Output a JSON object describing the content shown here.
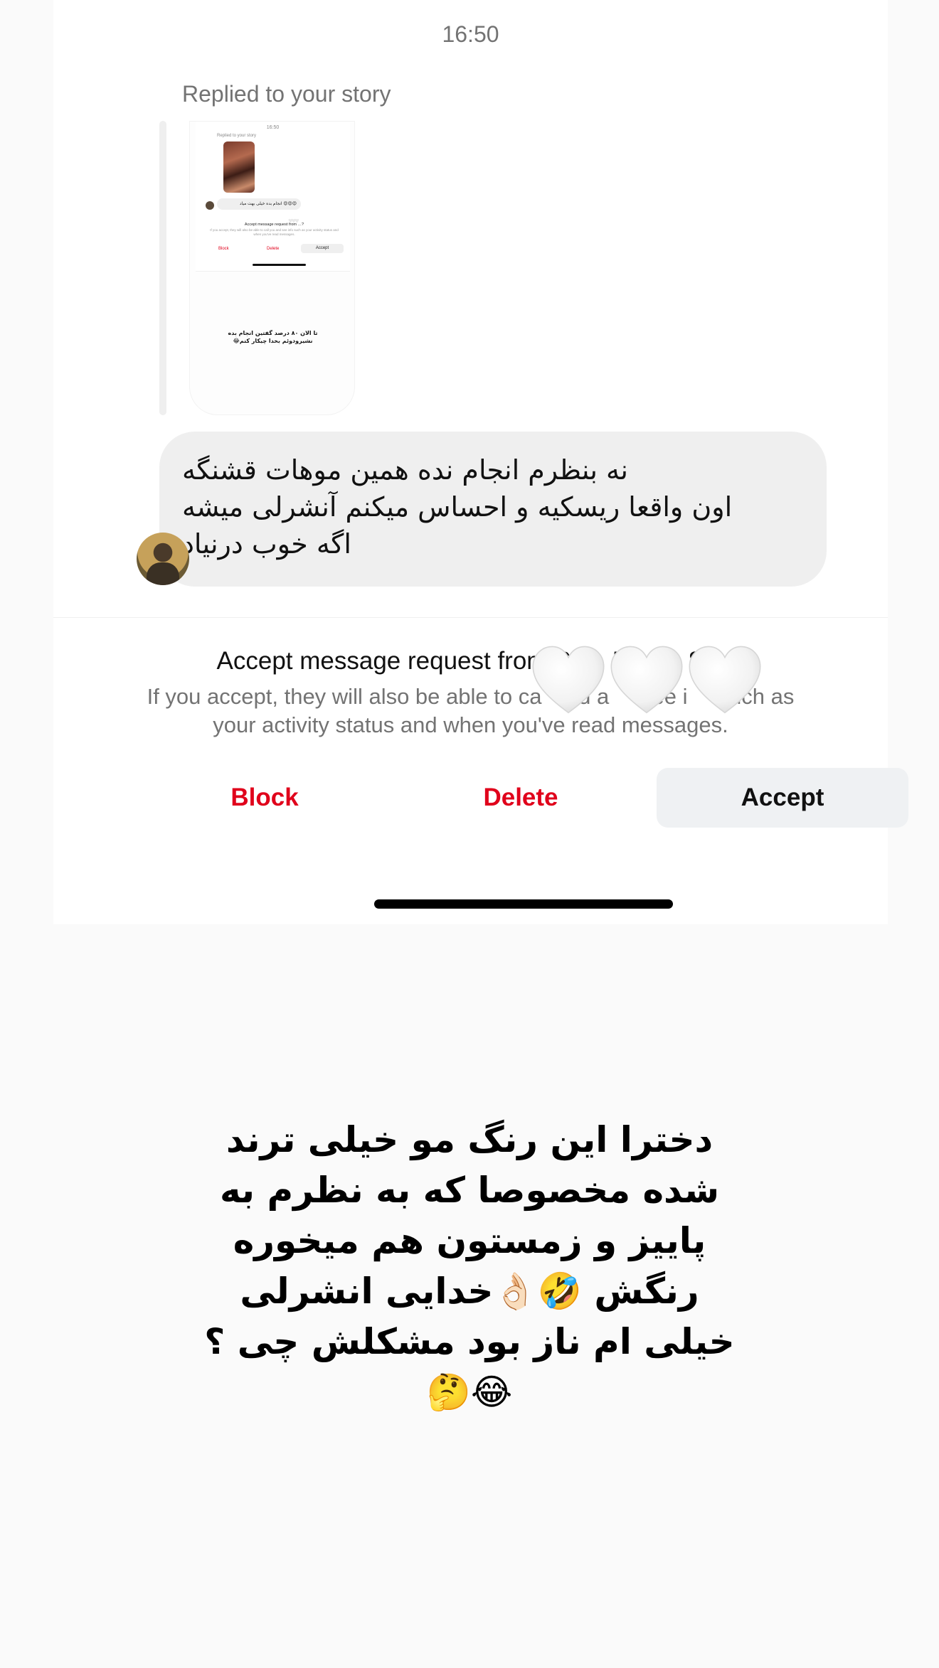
{
  "thread": {
    "timestamp": "16:50",
    "reply_label": "Replied to your story",
    "story_preview": {
      "time": "16:50",
      "replied_label": "Replied to your story",
      "message": "انجام بده خیلی بهت میاد 😍😍😍",
      "request_text": "Accept message request from …?",
      "request_sub": "If you accept, they will also be able to call you and see info such as your activity status and when you've read messages.",
      "block_label": "Block",
      "delete_label": "Delete",
      "accept_label": "Accept",
      "caption": "تا الان ۸۰ درصد گفتین انجام بده\nنشیرودوئم بخدا چیکار کنم😂"
    },
    "message": "نه بنظرم انجام نده همین موهات قشنگه\nاون واقعا ریسکیه و احساس میکنم آنشرلی میشه\nاگه خوب درنیاد"
  },
  "request": {
    "title": "Accept message request from Sa    5         8)?",
    "subtitle": "If you accept, they will also be able to ca      d a       ee i     such as your activity status and when you've read messages.",
    "block_label": "Block",
    "delete_label": "Delete",
    "accept_label": "Accept"
  },
  "story_caption": "دخترا این رنگ مو خیلی ترند\nشده مخصوصا که به نظرم به\nپاییز و زمستون هم میخوره\nرنگش 🤣👌🏻خدایی انشرلی\nخیلی ام ناز بود مشکلش چی ؟\n😂🤔",
  "colors": {
    "danger": "#e0001b",
    "secondary_text": "#737373",
    "bubble_bg": "#efefef",
    "accept_bg": "#eff1f3"
  },
  "icons": {
    "sticker": "white-heart-emoji"
  }
}
